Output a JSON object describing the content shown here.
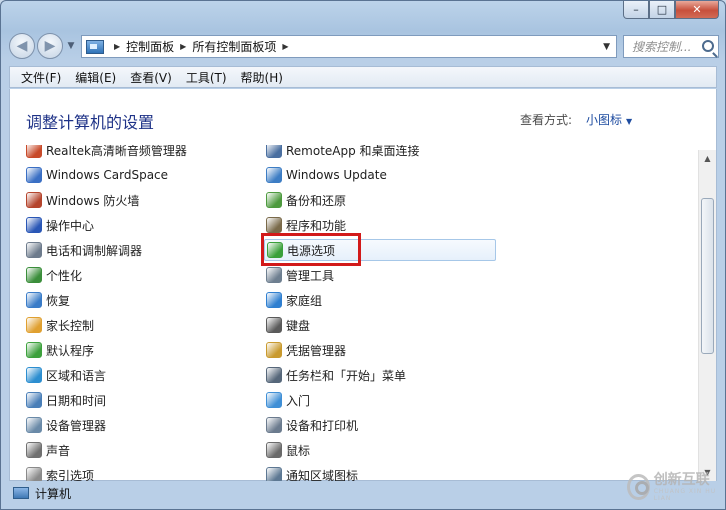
{
  "window": {
    "caption_buttons": [
      "minimize",
      "maximize",
      "close"
    ]
  },
  "navbar": {
    "address_segments": [
      "控制面板",
      "所有控制面板项"
    ],
    "search_placeholder": "搜索控制..."
  },
  "menubar": {
    "items": [
      "文件(F)",
      "编辑(E)",
      "查看(V)",
      "工具(T)",
      "帮助(H)"
    ]
  },
  "content": {
    "heading": "调整计算机的设置",
    "view_label": "查看方式:",
    "view_value": "小图标"
  },
  "items": {
    "left": [
      {
        "label": "Realtek高清晰音频管理器",
        "icon": "speaker-icon",
        "color": "#c84a2a"
      },
      {
        "label": "Windows CardSpace",
        "icon": "cardspace-icon",
        "color": "#3a6fc4"
      },
      {
        "label": "Windows 防火墙",
        "icon": "firewall-icon",
        "color": "#b5442c"
      },
      {
        "label": "操作中心",
        "icon": "flag-icon",
        "color": "#2a57b6"
      },
      {
        "label": "电话和调制解调器",
        "icon": "phone-icon",
        "color": "#6d7b8c"
      },
      {
        "label": "个性化",
        "icon": "monitor-icon",
        "color": "#3b8e3b"
      },
      {
        "label": "恢复",
        "icon": "recovery-icon",
        "color": "#3a7cc8"
      },
      {
        "label": "家长控制",
        "icon": "parental-icon",
        "color": "#e0a030"
      },
      {
        "label": "默认程序",
        "icon": "default-programs-icon",
        "color": "#3da13d"
      },
      {
        "label": "区域和语言",
        "icon": "globe-icon",
        "color": "#2c8ed0"
      },
      {
        "label": "日期和时间",
        "icon": "clock-icon",
        "color": "#4a7fb8"
      },
      {
        "label": "设备管理器",
        "icon": "device-manager-icon",
        "color": "#6a8aa8"
      },
      {
        "label": "声音",
        "icon": "sound-icon",
        "color": "#707070"
      },
      {
        "label": "索引选项",
        "icon": "index-icon",
        "color": "#8a8a8a"
      }
    ],
    "right": [
      {
        "label": "RemoteApp 和桌面连接",
        "icon": "remoteapp-icon",
        "color": "#4a6fa0"
      },
      {
        "label": "Windows Update",
        "icon": "windows-update-icon",
        "color": "#3d7dc4"
      },
      {
        "label": "备份和还原",
        "icon": "backup-icon",
        "color": "#4d9a3e"
      },
      {
        "label": "程序和功能",
        "icon": "programs-icon",
        "color": "#7a6a4a"
      },
      {
        "label": "电源选项",
        "icon": "power-icon",
        "color": "#3aa03a"
      },
      {
        "label": "管理工具",
        "icon": "admin-tools-icon",
        "color": "#6e7f90"
      },
      {
        "label": "家庭组",
        "icon": "homegroup-icon",
        "color": "#2f7fd0"
      },
      {
        "label": "键盘",
        "icon": "keyboard-icon",
        "color": "#5a5a5a"
      },
      {
        "label": "凭据管理器",
        "icon": "credential-icon",
        "color": "#c99a2e"
      },
      {
        "label": "任务栏和「开始」菜单",
        "icon": "taskbar-icon",
        "color": "#56677a"
      },
      {
        "label": "入门",
        "icon": "getting-started-icon",
        "color": "#3f8fd6"
      },
      {
        "label": "设备和打印机",
        "icon": "printer-icon",
        "color": "#6b7b8e"
      },
      {
        "label": "鼠标",
        "icon": "mouse-icon",
        "color": "#6a6a6a"
      },
      {
        "label": "通知区域图标",
        "icon": "notification-icon",
        "color": "#5d7893"
      }
    ],
    "selected_right_index": 4
  },
  "statusbar": {
    "text": "计算机"
  },
  "watermark": {
    "text": "创新互联",
    "sub": "CHUANG XIN HU LIAN"
  }
}
